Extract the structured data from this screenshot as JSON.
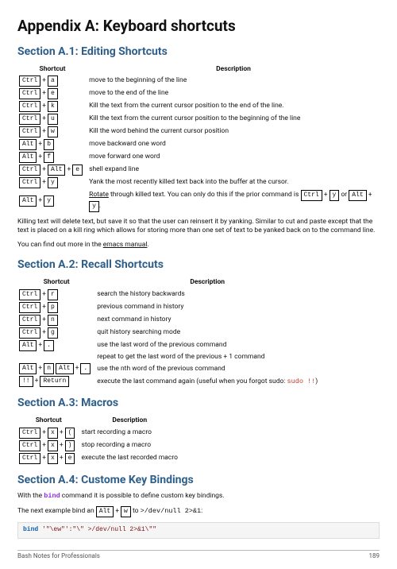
{
  "title": "Appendix A: Keyboard shortcuts",
  "sections": {
    "a1": {
      "heading": "Section A.1: Editing Shortcuts",
      "th_sc": "Shortcut",
      "th_desc": "Description"
    },
    "a2": {
      "heading": "Section A.2: Recall Shortcuts",
      "th_sc": "Shortcut",
      "th_desc": "Description"
    },
    "a3": {
      "heading": "Section A.3: Macros",
      "th_sc": "Shortcut",
      "th_desc": "Description"
    },
    "a4": {
      "heading": "Section A.4: Custome Key Bindings"
    }
  },
  "editing": [
    {
      "k": [
        "Ctrl",
        "a"
      ],
      "d": "move to the beginning of the line"
    },
    {
      "k": [
        "Ctrl",
        "e"
      ],
      "d": "move to the end of the line"
    },
    {
      "k": [
        "Ctrl",
        "k"
      ],
      "d": "Kill the text from the current cursor position to the end of the line."
    },
    {
      "k": [
        "Ctrl",
        "u"
      ],
      "d": "Kill the text from the current cursor position to the beginning of the line"
    },
    {
      "k": [
        "Ctrl",
        "w"
      ],
      "d": "Kill the word behind the current cursor position"
    },
    {
      "k": [
        "Alt",
        "b"
      ],
      "d": "move backward one word"
    },
    {
      "k": [
        "Alt",
        "f"
      ],
      "d": "move forward one word"
    },
    {
      "k": [
        "Ctrl",
        "Alt",
        "e"
      ],
      "d": "shell expand line"
    },
    {
      "k": [
        "Ctrl",
        "y"
      ],
      "d": "Yank the most recently killed text back into the buffer at the cursor."
    }
  ],
  "editing_last": {
    "k": [
      "Alt",
      "y"
    ],
    "pre": "Rotate",
    "mid": " through killed text. You can only do this if the prior command is ",
    "k2": [
      "Ctrl",
      "y"
    ],
    "or": " or ",
    "k3": [
      "Alt",
      "y"
    ],
    "dot": "."
  },
  "editing_note": "Killing text will delete text, but save it so that the user can reinsert it by yanking. Similar to cut and paste except that the text is placed on a kill ring which allows for storing more than one set of text to be yanked back on to the command line.",
  "editing_more_pre": "You can find out more in the ",
  "editing_more_link": "emacs manual",
  "editing_more_post": ".",
  "recall": [
    {
      "k": [
        "Ctrl",
        "r"
      ],
      "d": "search the history backwards"
    },
    {
      "k": [
        "Ctrl",
        "p"
      ],
      "d": "previous command in history"
    },
    {
      "k": [
        "Ctrl",
        "n"
      ],
      "d": "next command in history"
    },
    {
      "k": [
        "Ctrl",
        "g"
      ],
      "d": "quit history searching mode"
    },
    {
      "k": [
        "Alt",
        "."
      ],
      "d": "use the last word of the previous command"
    }
  ],
  "recall_repeat": "repeat to get the last word of the previous + 1 command",
  "recall_nth": {
    "k1": [
      "Alt",
      "n"
    ],
    "k2": [
      "Alt",
      "."
    ],
    "d": "use the nth word of the previous command"
  },
  "recall_bang": {
    "k": [
      "!!",
      "Return"
    ],
    "pre": "execute the last command again (useful when you forgot sudo: ",
    "code": "sudo !!",
    "post": ")"
  },
  "macros": [
    {
      "k": [
        "Ctrl",
        "x",
        "("
      ],
      "d": "start recording a macro"
    },
    {
      "k": [
        "Ctrl",
        "x",
        ")"
      ],
      "d": "stop recording a macro"
    },
    {
      "k": [
        "Ctrl",
        "x",
        "e"
      ],
      "d": "execute the last recorded macro"
    }
  ],
  "a4_intro_pre": "With the ",
  "a4_intro_cmd": "bind",
  "a4_intro_post": " command it is possible to define custom key bindings.",
  "a4_example_pre": "The next example bind an ",
  "a4_example_k": [
    "Alt",
    "w"
  ],
  "a4_example_mid": " to ",
  "a4_example_code": ">/dev/null 2>&1",
  "a4_example_post": ":",
  "codebox": {
    "cmd": "bind",
    "arg": "'\"\\ew\"':\"\\\" >/dev/null 2>&1\\\"\""
  },
  "footer": {
    "left": "Bash Notes for Professionals",
    "right": "189"
  }
}
